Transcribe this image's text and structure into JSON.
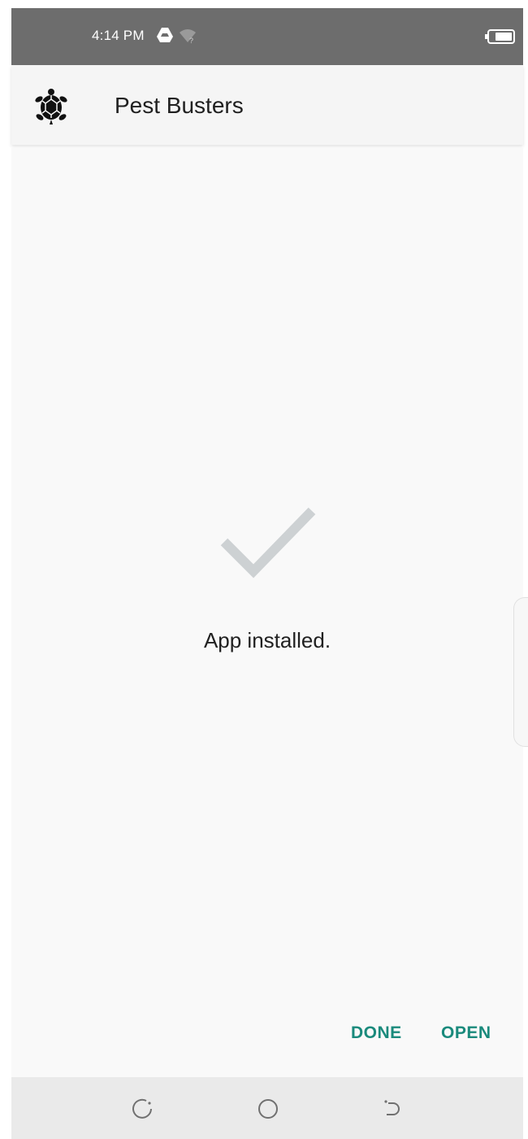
{
  "status_bar": {
    "time": "4:14 PM",
    "icons": [
      "google-drive-icon",
      "wifi-icon",
      "battery-icon"
    ]
  },
  "app_bar": {
    "icon": "turtle-icon",
    "title": "Pest Busters"
  },
  "main": {
    "status_icon": "checkmark-icon",
    "message": "App installed."
  },
  "actions": {
    "done_label": "DONE",
    "open_label": "OPEN"
  },
  "nav_bar": {
    "icons": [
      "recent-apps-icon",
      "home-icon",
      "back-icon"
    ]
  },
  "colors": {
    "status_bar_bg": "#6d6d6d",
    "app_bar_bg": "#f5f5f5",
    "content_bg": "#f9f9f9",
    "accent": "#1a8a7c",
    "checkmark": "#cdd1d3",
    "nav_bar_bg": "#eaeaea"
  }
}
